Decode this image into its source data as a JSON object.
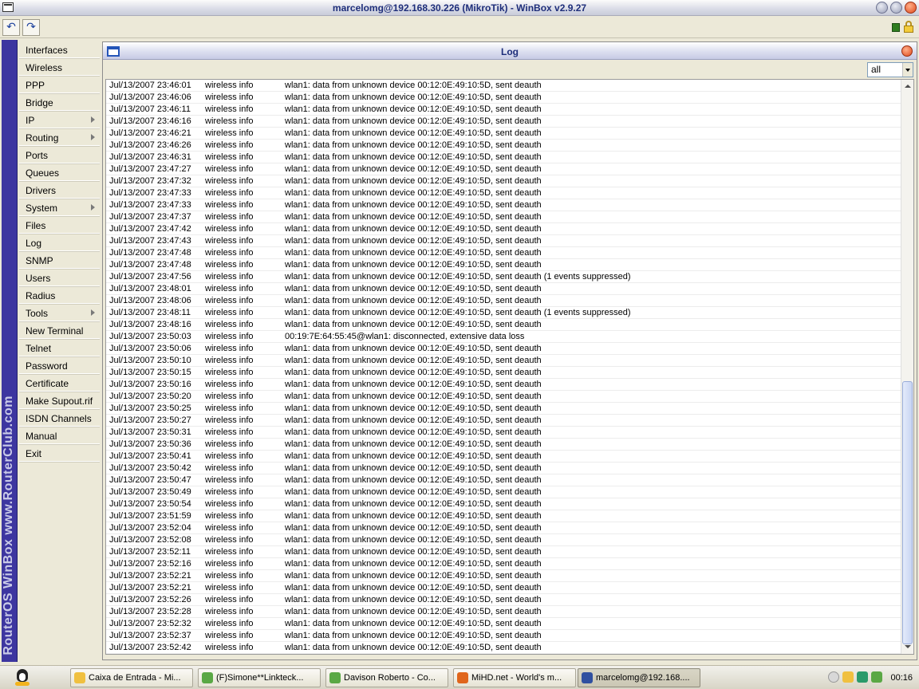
{
  "window": {
    "title": "marcelomg@192.168.30.226 (MikroTik) - WinBox v2.9.27"
  },
  "toolbar": {
    "undo_symbol": "↶",
    "redo_symbol": "↷"
  },
  "sidebar": {
    "brand": "RouterOS WinBox   www.RouterClub.com",
    "items": [
      {
        "label": "Interfaces"
      },
      {
        "label": "Wireless"
      },
      {
        "label": "PPP"
      },
      {
        "label": "Bridge"
      },
      {
        "label": "IP",
        "submenu": true
      },
      {
        "label": "Routing",
        "submenu": true
      },
      {
        "label": "Ports"
      },
      {
        "label": "Queues"
      },
      {
        "label": "Drivers"
      },
      {
        "label": "System",
        "submenu": true
      },
      {
        "label": "Files"
      },
      {
        "label": "Log"
      },
      {
        "label": "SNMP"
      },
      {
        "label": "Users"
      },
      {
        "label": "Radius"
      },
      {
        "label": "Tools",
        "submenu": true
      },
      {
        "label": "New Terminal"
      },
      {
        "label": "Telnet"
      },
      {
        "label": "Password"
      },
      {
        "label": "Certificate"
      },
      {
        "label": "Make Supout.rif"
      },
      {
        "label": "ISDN Channels"
      },
      {
        "label": "Manual"
      },
      {
        "label": "Exit"
      }
    ]
  },
  "log_window": {
    "title": "Log",
    "filter_value": "all",
    "entries": [
      {
        "time": "Jul/13/2007 23:46:01",
        "topics": "wireless info",
        "message": "wlan1: data from unknown device 00:12:0E:49:10:5D, sent deauth"
      },
      {
        "time": "Jul/13/2007 23:46:06",
        "topics": "wireless info",
        "message": "wlan1: data from unknown device 00:12:0E:49:10:5D, sent deauth"
      },
      {
        "time": "Jul/13/2007 23:46:11",
        "topics": "wireless info",
        "message": "wlan1: data from unknown device 00:12:0E:49:10:5D, sent deauth"
      },
      {
        "time": "Jul/13/2007 23:46:16",
        "topics": "wireless info",
        "message": "wlan1: data from unknown device 00:12:0E:49:10:5D, sent deauth"
      },
      {
        "time": "Jul/13/2007 23:46:21",
        "topics": "wireless info",
        "message": "wlan1: data from unknown device 00:12:0E:49:10:5D, sent deauth"
      },
      {
        "time": "Jul/13/2007 23:46:26",
        "topics": "wireless info",
        "message": "wlan1: data from unknown device 00:12:0E:49:10:5D, sent deauth"
      },
      {
        "time": "Jul/13/2007 23:46:31",
        "topics": "wireless info",
        "message": "wlan1: data from unknown device 00:12:0E:49:10:5D, sent deauth"
      },
      {
        "time": "Jul/13/2007 23:47:27",
        "topics": "wireless info",
        "message": "wlan1: data from unknown device 00:12:0E:49:10:5D, sent deauth"
      },
      {
        "time": "Jul/13/2007 23:47:32",
        "topics": "wireless info",
        "message": "wlan1: data from unknown device 00:12:0E:49:10:5D, sent deauth"
      },
      {
        "time": "Jul/13/2007 23:47:33",
        "topics": "wireless info",
        "message": "wlan1: data from unknown device 00:12:0E:49:10:5D, sent deauth"
      },
      {
        "time": "Jul/13/2007 23:47:33",
        "topics": "wireless info",
        "message": "wlan1: data from unknown device 00:12:0E:49:10:5D, sent deauth"
      },
      {
        "time": "Jul/13/2007 23:47:37",
        "topics": "wireless info",
        "message": "wlan1: data from unknown device 00:12:0E:49:10:5D, sent deauth"
      },
      {
        "time": "Jul/13/2007 23:47:42",
        "topics": "wireless info",
        "message": "wlan1: data from unknown device 00:12:0E:49:10:5D, sent deauth"
      },
      {
        "time": "Jul/13/2007 23:47:43",
        "topics": "wireless info",
        "message": "wlan1: data from unknown device 00:12:0E:49:10:5D, sent deauth"
      },
      {
        "time": "Jul/13/2007 23:47:48",
        "topics": "wireless info",
        "message": "wlan1: data from unknown device 00:12:0E:49:10:5D, sent deauth"
      },
      {
        "time": "Jul/13/2007 23:47:48",
        "topics": "wireless info",
        "message": "wlan1: data from unknown device 00:12:0E:49:10:5D, sent deauth"
      },
      {
        "time": "Jul/13/2007 23:47:56",
        "topics": "wireless info",
        "message": "wlan1: data from unknown device 00:12:0E:49:10:5D, sent deauth (1 events suppressed)"
      },
      {
        "time": "Jul/13/2007 23:48:01",
        "topics": "wireless info",
        "message": "wlan1: data from unknown device 00:12:0E:49:10:5D, sent deauth"
      },
      {
        "time": "Jul/13/2007 23:48:06",
        "topics": "wireless info",
        "message": "wlan1: data from unknown device 00:12:0E:49:10:5D, sent deauth"
      },
      {
        "time": "Jul/13/2007 23:48:11",
        "topics": "wireless info",
        "message": "wlan1: data from unknown device 00:12:0E:49:10:5D, sent deauth (1 events suppressed)"
      },
      {
        "time": "Jul/13/2007 23:48:16",
        "topics": "wireless info",
        "message": "wlan1: data from unknown device 00:12:0E:49:10:5D, sent deauth"
      },
      {
        "time": "Jul/13/2007 23:50:03",
        "topics": "wireless info",
        "message": "00:19:7E:64:55:45@wlan1: disconnected, extensive data loss"
      },
      {
        "time": "Jul/13/2007 23:50:06",
        "topics": "wireless info",
        "message": "wlan1: data from unknown device 00:12:0E:49:10:5D, sent deauth"
      },
      {
        "time": "Jul/13/2007 23:50:10",
        "topics": "wireless info",
        "message": "wlan1: data from unknown device 00:12:0E:49:10:5D, sent deauth"
      },
      {
        "time": "Jul/13/2007 23:50:15",
        "topics": "wireless info",
        "message": "wlan1: data from unknown device 00:12:0E:49:10:5D, sent deauth"
      },
      {
        "time": "Jul/13/2007 23:50:16",
        "topics": "wireless info",
        "message": "wlan1: data from unknown device 00:12:0E:49:10:5D, sent deauth"
      },
      {
        "time": "Jul/13/2007 23:50:20",
        "topics": "wireless info",
        "message": "wlan1: data from unknown device 00:12:0E:49:10:5D, sent deauth"
      },
      {
        "time": "Jul/13/2007 23:50:25",
        "topics": "wireless info",
        "message": "wlan1: data from unknown device 00:12:0E:49:10:5D, sent deauth"
      },
      {
        "time": "Jul/13/2007 23:50:27",
        "topics": "wireless info",
        "message": "wlan1: data from unknown device 00:12:0E:49:10:5D, sent deauth"
      },
      {
        "time": "Jul/13/2007 23:50:31",
        "topics": "wireless info",
        "message": "wlan1: data from unknown device 00:12:0E:49:10:5D, sent deauth"
      },
      {
        "time": "Jul/13/2007 23:50:36",
        "topics": "wireless info",
        "message": "wlan1: data from unknown device 00:12:0E:49:10:5D, sent deauth"
      },
      {
        "time": "Jul/13/2007 23:50:41",
        "topics": "wireless info",
        "message": "wlan1: data from unknown device 00:12:0E:49:10:5D, sent deauth"
      },
      {
        "time": "Jul/13/2007 23:50:42",
        "topics": "wireless info",
        "message": "wlan1: data from unknown device 00:12:0E:49:10:5D, sent deauth"
      },
      {
        "time": "Jul/13/2007 23:50:47",
        "topics": "wireless info",
        "message": "wlan1: data from unknown device 00:12:0E:49:10:5D, sent deauth"
      },
      {
        "time": "Jul/13/2007 23:50:49",
        "topics": "wireless info",
        "message": "wlan1: data from unknown device 00:12:0E:49:10:5D, sent deauth"
      },
      {
        "time": "Jul/13/2007 23:50:54",
        "topics": "wireless info",
        "message": "wlan1: data from unknown device 00:12:0E:49:10:5D, sent deauth"
      },
      {
        "time": "Jul/13/2007 23:51:59",
        "topics": "wireless info",
        "message": "wlan1: data from unknown device 00:12:0E:49:10:5D, sent deauth"
      },
      {
        "time": "Jul/13/2007 23:52:04",
        "topics": "wireless info",
        "message": "wlan1: data from unknown device 00:12:0E:49:10:5D, sent deauth"
      },
      {
        "time": "Jul/13/2007 23:52:08",
        "topics": "wireless info",
        "message": "wlan1: data from unknown device 00:12:0E:49:10:5D, sent deauth"
      },
      {
        "time": "Jul/13/2007 23:52:11",
        "topics": "wireless info",
        "message": "wlan1: data from unknown device 00:12:0E:49:10:5D, sent deauth"
      },
      {
        "time": "Jul/13/2007 23:52:16",
        "topics": "wireless info",
        "message": "wlan1: data from unknown device 00:12:0E:49:10:5D, sent deauth"
      },
      {
        "time": "Jul/13/2007 23:52:21",
        "topics": "wireless info",
        "message": "wlan1: data from unknown device 00:12:0E:49:10:5D, sent deauth"
      },
      {
        "time": "Jul/13/2007 23:52:21",
        "topics": "wireless info",
        "message": "wlan1: data from unknown device 00:12:0E:49:10:5D, sent deauth"
      },
      {
        "time": "Jul/13/2007 23:52:26",
        "topics": "wireless info",
        "message": "wlan1: data from unknown device 00:12:0E:49:10:5D, sent deauth"
      },
      {
        "time": "Jul/13/2007 23:52:28",
        "topics": "wireless info",
        "message": "wlan1: data from unknown device 00:12:0E:49:10:5D, sent deauth"
      },
      {
        "time": "Jul/13/2007 23:52:32",
        "topics": "wireless info",
        "message": "wlan1: data from unknown device 00:12:0E:49:10:5D, sent deauth"
      },
      {
        "time": "Jul/13/2007 23:52:37",
        "topics": "wireless info",
        "message": "wlan1: data from unknown device 00:12:0E:49:10:5D, sent deauth"
      },
      {
        "time": "Jul/13/2007 23:52:42",
        "topics": "wireless info",
        "message": "wlan1: data from unknown device 00:12:0E:49:10:5D, sent deauth"
      }
    ]
  },
  "taskbar": {
    "tasks": [
      {
        "label": "Caixa de Entrada - Mi...",
        "icon": "mail-icon",
        "color": "#f0c040"
      },
      {
        "label": "(F)Simone**Linkteck...",
        "icon": "messenger-icon",
        "color": "#5aa845"
      },
      {
        "label": "Davison Roberto - Co...",
        "icon": "messenger-icon",
        "color": "#5aa845"
      },
      {
        "label": "MiHD.net - World's m...",
        "icon": "firefox-icon",
        "color": "#e0661c"
      },
      {
        "label": "marcelomg@192.168....",
        "icon": "winbox-icon",
        "color": "#3050a0",
        "active": true
      }
    ],
    "clock": "00:16"
  },
  "colors": {
    "brand_strip": "#3d36a0",
    "title_text": "#1e2e7a",
    "close_button": "#e04a1c"
  }
}
